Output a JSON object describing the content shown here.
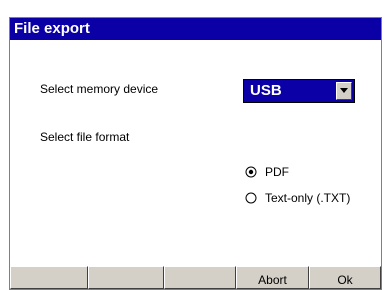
{
  "window": {
    "title": "File export"
  },
  "form": {
    "memory_device_label": "Select memory device",
    "memory_device_value": "USB",
    "file_format_label": "Select file format",
    "file_format_options": [
      {
        "label": "PDF",
        "selected": true
      },
      {
        "label": "Text-only (.TXT)",
        "selected": false
      }
    ]
  },
  "buttons": {
    "slots": [
      "",
      "",
      "",
      "Abort",
      "Ok"
    ]
  },
  "colors": {
    "titlebar": "#0a00a6",
    "selected_field": "#0a00a6",
    "button_face": "#d4d0c8"
  }
}
